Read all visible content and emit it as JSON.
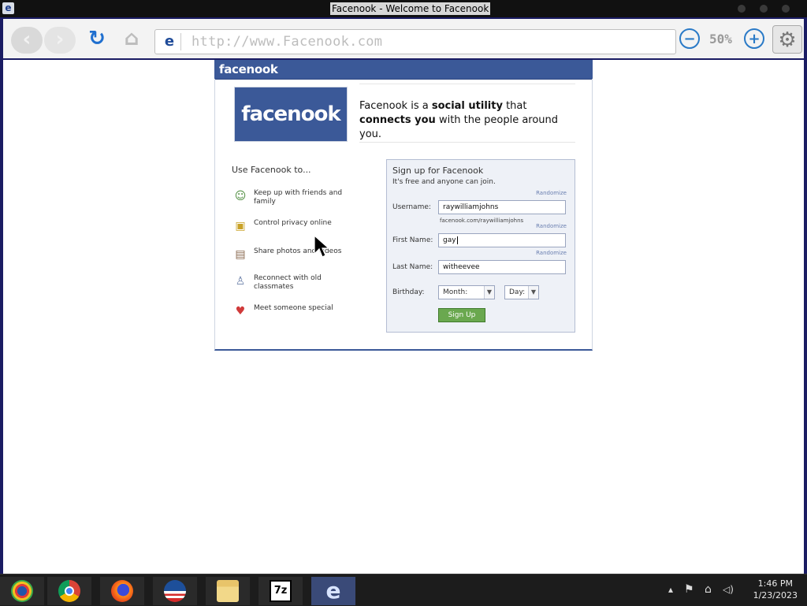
{
  "window": {
    "title": "Facenook - Welcome to Facenook",
    "app_icon": "e"
  },
  "browser": {
    "back_glyph": "‹",
    "forward_glyph": "›",
    "reload_glyph": "↻",
    "home_glyph": "⌂",
    "address_icon": "e",
    "url": "http://www.Facenook.com",
    "zoom_out_glyph": "−",
    "zoom_level": "50%",
    "zoom_in_glyph": "+",
    "settings_glyph": "⚙"
  },
  "page": {
    "brand_bar": "facenook",
    "logo": "facenook",
    "tagline": {
      "p1": "Facenook is a ",
      "b1": "social utility",
      "p2": " that ",
      "b2": "connects you",
      "p3": " with the people around you."
    },
    "use_title": "Use Facenook to...",
    "features": [
      {
        "text": "Keep up with friends and family",
        "icon": "friends-icon"
      },
      {
        "text": "Control privacy online",
        "icon": "lock-icon"
      },
      {
        "text": "Share photos and videos",
        "icon": "photo-icon"
      },
      {
        "text": "Reconnect with old classmates",
        "icon": "person-icon"
      },
      {
        "text": "Meet someone special",
        "icon": "heart-icon"
      }
    ],
    "signup": {
      "title": "Sign up for Facenook",
      "subtitle": "It's free and anyone can join.",
      "randomize": "Randomize",
      "username_label": "Username:",
      "username_value": "raywilliamjohns",
      "username_hint": "facenook.com/raywilliamjohns",
      "first_label": "First Name:",
      "first_value": "gay",
      "last_label": "Last Name:",
      "last_value": "witheevee",
      "birthday_label": "Birthday:",
      "month_value": "Month:",
      "day_value": "Day:",
      "button": "Sign Up"
    }
  },
  "taskbar": {
    "apps": [
      "start-icon",
      "chrome-icon",
      "firefox-icon",
      "obama-icon",
      "file-manager-icon",
      "7zip-icon",
      "ie-icon"
    ],
    "sevenzip_label": "7z",
    "ie_label": "e",
    "tray_arrow": "▴",
    "flag_glyph": "⚑",
    "network_glyph": "⌂",
    "volume_glyph": "◁)",
    "time": "1:46 PM",
    "date": "1/23/2023"
  },
  "colors": {
    "facebook_blue": "#3b5998",
    "signup_green": "#6aa84f",
    "frame_navy": "#1a1c63"
  }
}
